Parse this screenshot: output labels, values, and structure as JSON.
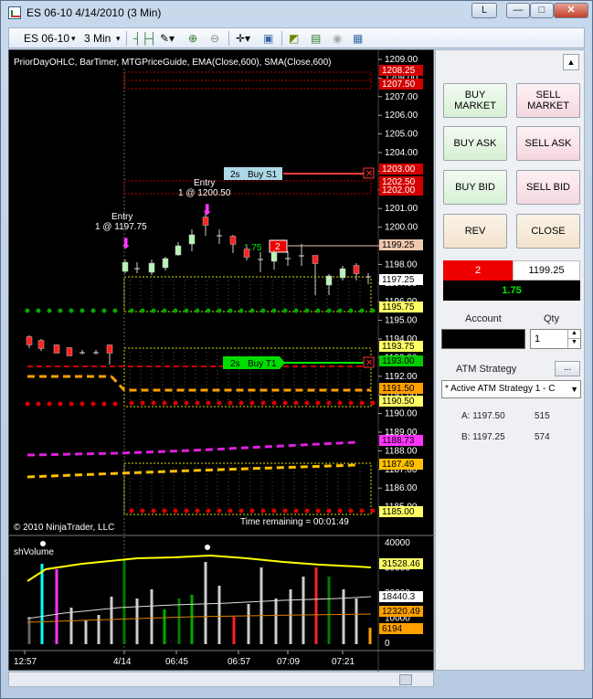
{
  "window": {
    "title": "ES 06-10  4/14/2010 (3 Min)",
    "buttons": {
      "l": "L",
      "min": "—",
      "max": "□",
      "close": "✕"
    }
  },
  "toolbar": {
    "instrument": "ES 06-10",
    "interval": "3 Min",
    "icons": [
      "bar-style-icon",
      "pencil-icon",
      "zoom-in-icon",
      "zoom-out-icon",
      "crosshair-icon",
      "properties-icon",
      "strategy-icon",
      "indicator-icon",
      "globe-icon",
      "data-box-icon"
    ]
  },
  "chart": {
    "indicators_label": "PriorDayOHLC, BarTimer, MTGPriceGuide, EMA(Close,600), SMA(Close,600)",
    "copyright": "© 2010 NinjaTrader, LLC",
    "time_remaining": "Time remaining = 00:01:49",
    "volume_label": "shVolume",
    "price_ticks": [
      "1209.00",
      "1208.00",
      "1207.00",
      "1206.00",
      "1205.00",
      "1204.00",
      "1203.00",
      "1202.00",
      "1201.00",
      "1200.00",
      "1199.00",
      "1198.00",
      "1197.00",
      "1196.00",
      "1195.00",
      "1194.00",
      "1193.00",
      "1192.00",
      "1191.00",
      "1190.00",
      "1189.00",
      "1188.00",
      "1187.00",
      "1186.00",
      "1185.00"
    ],
    "price_markers": [
      {
        "text": "1208.25",
        "bg": "#d40000",
        "fg": "#fff"
      },
      {
        "text": "1207.50",
        "bg": "#d40000",
        "fg": "#fff"
      },
      {
        "text": "1203.00",
        "bg": "#d40000",
        "fg": "#fff"
      },
      {
        "text": "1202.50",
        "bg": "#d40000",
        "fg": "#fff"
      },
      {
        "text": "1202.00",
        "bg": "#d40000",
        "fg": "#fff"
      },
      {
        "text": "1199.25",
        "bg": "#f0c8b0",
        "fg": "#000"
      },
      {
        "text": "1197.25",
        "bg": "#fff",
        "fg": "#000"
      },
      {
        "text": "1195.75",
        "bg": "#ffff66",
        "fg": "#000"
      },
      {
        "text": "1193.75",
        "bg": "#ffff66",
        "fg": "#000"
      },
      {
        "text": "1193.00",
        "bg": "#00cc00",
        "fg": "#000"
      },
      {
        "text": "1191.50",
        "bg": "#ffa000",
        "fg": "#000"
      },
      {
        "text": "1190.50",
        "bg": "#ffff66",
        "fg": "#000"
      },
      {
        "text": "1188.73",
        "bg": "#ff33ff",
        "fg": "#000"
      },
      {
        "text": "1187.49",
        "bg": "#ffc000",
        "fg": "#000"
      },
      {
        "text": "1185.00",
        "bg": "#ffff66",
        "fg": "#000"
      }
    ],
    "orders": {
      "stop": {
        "qty": "2s",
        "label": "Buy S1"
      },
      "target": {
        "qty": "2s",
        "label": "Buy T1"
      },
      "position": {
        "pnl": "1.75",
        "qty": "2"
      }
    },
    "entries": [
      {
        "label": "Entry",
        "detail": "1 @ 1197.75"
      },
      {
        "label": "Entry",
        "detail": "1 @ 1200.50"
      }
    ],
    "volume_ticks": [
      "40000",
      "30000",
      "20000",
      "10000",
      "0"
    ],
    "volume_markers": [
      {
        "text": "31528.46",
        "bg": "#ffff66"
      },
      {
        "text": "18440.3",
        "bg": "#ffffff"
      },
      {
        "text": "12320.49",
        "bg": "#ffa000"
      },
      {
        "text": "6194",
        "bg": "#ffa000"
      }
    ],
    "time_labels": [
      "12:57",
      "4/14",
      "06:45",
      "06:57",
      "07:09",
      "07:21"
    ]
  },
  "panel": {
    "buy_market": "BUY MARKET",
    "sell_market": "SELL MARKET",
    "buy_ask": "BUY ASK",
    "sell_ask": "SELL ASK",
    "buy_bid": "BUY BID",
    "sell_bid": "SELL BID",
    "rev": "REV",
    "close": "CLOSE",
    "position_qty": "2",
    "position_price": "1199.25",
    "pnl": "1.75",
    "account_label": "Account",
    "qty_label": "Qty",
    "qty_value": "1",
    "atm_label": "ATM Strategy",
    "atm_more": "...",
    "atm_selected": "* Active ATM Strategy 1 - C",
    "atm_rows": [
      {
        "k": "A: 1197.50",
        "v": "515"
      },
      {
        "k": "B: 1197.25",
        "v": "574"
      }
    ]
  }
}
